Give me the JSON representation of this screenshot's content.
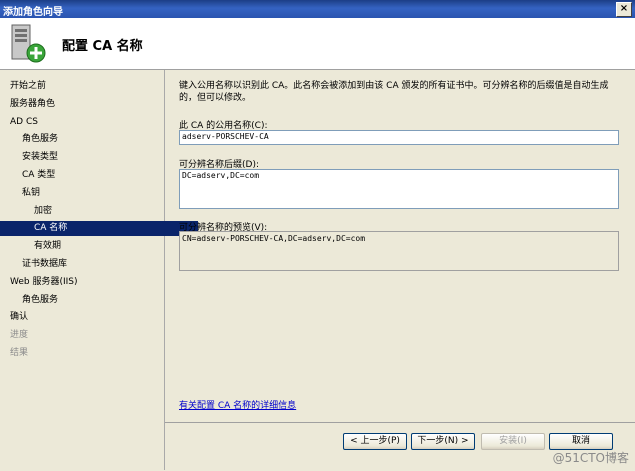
{
  "window": {
    "title": "添加角色向导",
    "close_glyph": "×"
  },
  "header": {
    "title": "配置 CA 名称",
    "icon": "server-add-icon"
  },
  "nav": {
    "items": [
      {
        "label": "开始之前",
        "level": 0,
        "state": "normal"
      },
      {
        "label": "服务器角色",
        "level": 0,
        "state": "normal"
      },
      {
        "label": "AD CS",
        "level": 0,
        "state": "normal"
      },
      {
        "label": "角色服务",
        "level": 1,
        "state": "normal"
      },
      {
        "label": "安装类型",
        "level": 1,
        "state": "normal"
      },
      {
        "label": "CA 类型",
        "level": 1,
        "state": "normal"
      },
      {
        "label": "私钥",
        "level": 1,
        "state": "normal"
      },
      {
        "label": "加密",
        "level": 2,
        "state": "normal"
      },
      {
        "label": "CA 名称",
        "level": 2,
        "state": "selected"
      },
      {
        "label": "有效期",
        "level": 2,
        "state": "normal"
      },
      {
        "label": "证书数据库",
        "level": 1,
        "state": "normal"
      },
      {
        "label": "Web 服务器(IIS)",
        "level": 0,
        "state": "normal"
      },
      {
        "label": "角色服务",
        "level": 1,
        "state": "normal"
      },
      {
        "label": "确认",
        "level": 0,
        "state": "normal"
      },
      {
        "label": "进度",
        "level": 0,
        "state": "dim"
      },
      {
        "label": "结果",
        "level": 0,
        "state": "dim"
      }
    ]
  },
  "main": {
    "description": "键入公用名称以识别此 CA。此名称会被添加到由该 CA 颁发的所有证书中。可分辨名称的后缀值是自动生成的，但可以修改。",
    "common_name_label": "此 CA 的公用名称(C):",
    "common_name_value": "adserv-PORSCHEV-CA",
    "suffix_label": "可分辨名称后缀(D):",
    "suffix_value": "DC=adserv,DC=com",
    "preview_label": "可分辨名称的预览(V):",
    "preview_value": "CN=adserv-PORSCHEV-CA,DC=adserv,DC=com",
    "more_info_link": "有关配置 CA 名称的详细信息"
  },
  "buttons": {
    "back": "< 上一步(P)",
    "next": "下一步(N) >",
    "install": "安装(I)",
    "cancel": "取消"
  },
  "watermark": "@51CTO博客"
}
